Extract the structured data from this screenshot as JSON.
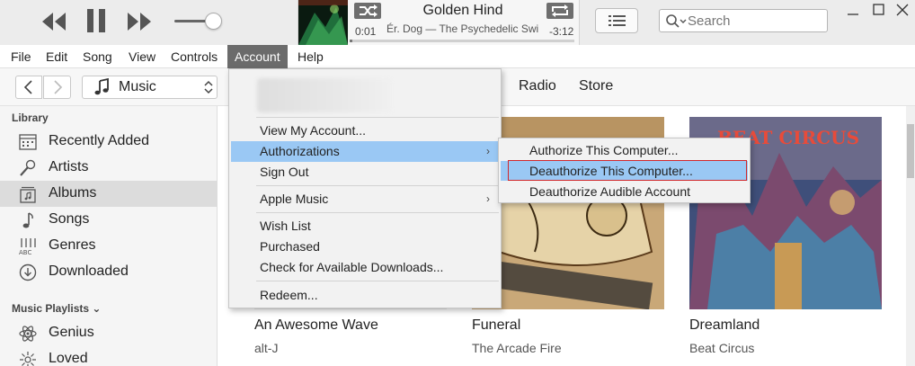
{
  "colors": {
    "menu_highlight": "#9ac8f4",
    "active_menu_bg": "#6b6b6b",
    "callout_outline": "#d0282c"
  },
  "player": {
    "prev_icon": "rewind-icon",
    "pause_icon": "pause-icon",
    "next_icon": "fast-forward-icon",
    "volume_level": 0.8,
    "now_playing": {
      "title": "Golden Hind",
      "subtitle": "Ér. Dog — The Psychedelic Swi",
      "elapsed": "0:01",
      "remaining": "-3:12",
      "progress": 0.01
    },
    "shuffle_icon": "shuffle-icon",
    "repeat_icon": "repeat-icon",
    "list_icon": "up-next-list-icon"
  },
  "search": {
    "placeholder": "Search",
    "icon": "search-icon"
  },
  "window_controls": {
    "minimize": "minimize-icon",
    "maximize": "maximize-icon",
    "close": "close-icon"
  },
  "menubar": [
    "File",
    "Edit",
    "Song",
    "View",
    "Controls",
    "Account",
    "Help"
  ],
  "nav": {
    "media_selector": "Music",
    "tabs": [
      "Radio",
      "Store"
    ]
  },
  "sidebar": {
    "library_header": "Library",
    "library_items": [
      {
        "label": "Recently Added",
        "icon": "recently-added-icon"
      },
      {
        "label": "Artists",
        "icon": "microphone-icon"
      },
      {
        "label": "Albums",
        "icon": "album-icon",
        "selected": true
      },
      {
        "label": "Songs",
        "icon": "music-note-icon"
      },
      {
        "label": "Genres",
        "icon": "genres-icon"
      },
      {
        "label": "Downloaded",
        "icon": "download-icon"
      }
    ],
    "playlists_header": "Music Playlists ⌄",
    "playlist_items": [
      {
        "label": "Genius",
        "icon": "genius-icon"
      },
      {
        "label": "Loved",
        "icon": "heart-icon"
      }
    ]
  },
  "albums": [
    {
      "title": "An Awesome Wave",
      "artist": "alt-J"
    },
    {
      "title": "Funeral",
      "artist": "The Arcade Fire"
    },
    {
      "title": "Dreamland",
      "artist": "Beat Circus"
    }
  ],
  "account_menu": {
    "items": [
      {
        "label": "View My Account..."
      },
      {
        "label": "Authorizations",
        "submenu": true,
        "highlighted": true
      },
      {
        "label": "Sign Out"
      },
      {
        "label": "Apple Music",
        "submenu": true
      },
      {
        "label": "Wish List"
      },
      {
        "label": "Purchased"
      },
      {
        "label": "Check for Available Downloads..."
      },
      {
        "label": "Redeem..."
      }
    ],
    "submenu_arrow": "›"
  },
  "authorizations_submenu": {
    "items": [
      {
        "label": "Authorize This Computer..."
      },
      {
        "label": "Deauthorize This Computer...",
        "highlighted": true
      },
      {
        "label": "Deauthorize Audible Account"
      }
    ]
  },
  "album_art_text": {
    "beat_circus": "BEAT CIRCUS"
  }
}
